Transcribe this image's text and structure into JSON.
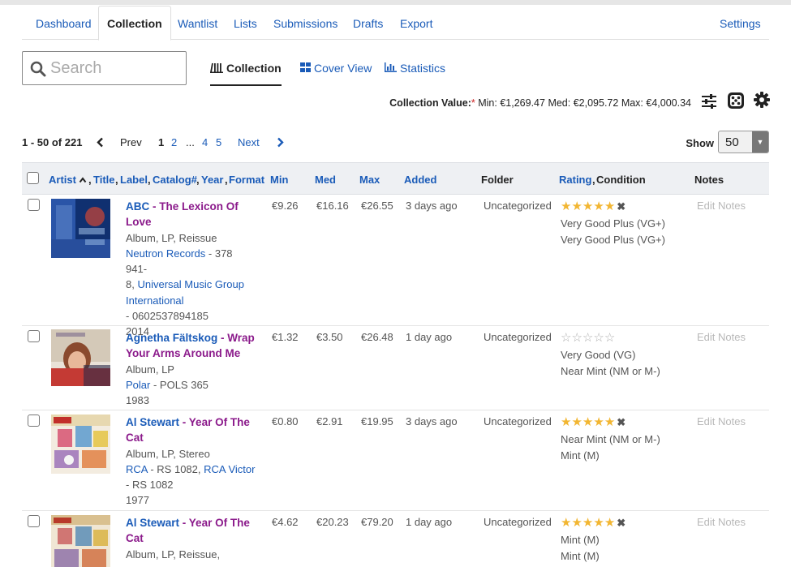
{
  "nav": {
    "tabs": [
      "Dashboard",
      "Collection",
      "Wantlist",
      "Lists",
      "Submissions",
      "Drafts",
      "Export"
    ],
    "active": "Collection",
    "settings": "Settings"
  },
  "search": {
    "placeholder": "Search",
    "value": ""
  },
  "views": {
    "collection": "Collection",
    "cover_view": "Cover View",
    "statistics": "Statistics"
  },
  "collection_value": {
    "label": "Collection Value:",
    "asterisk": "*",
    "min_label": "Min:",
    "min": "€1,269.47",
    "med_label": "Med:",
    "med": "€2,095.72",
    "max_label": "Max:",
    "max": "€4,000.34"
  },
  "pager": {
    "range": "1 - 50 of 221",
    "prev": "Prev",
    "pages": [
      "1",
      "2",
      "...",
      "4",
      "5"
    ],
    "next": "Next"
  },
  "show": {
    "label": "Show",
    "value": "50"
  },
  "table": {
    "headers": {
      "artist": "Artist",
      "title": "Title",
      "label": "Label",
      "catalog": "Catalog#",
      "year": "Year",
      "format": "Format",
      "min": "Min",
      "med": "Med",
      "max": "Max",
      "added": "Added",
      "folder": "Folder",
      "rating": "Rating",
      "condition": "Condition",
      "notes": "Notes"
    },
    "rows": [
      {
        "artist": "ABC",
        "sep": " - ",
        "title_line1": "The Lexicon Of",
        "title_line2": "Love",
        "format": "Album, LP, Reissue",
        "label1": "Neutron Records",
        "cat1": " - 378 941-",
        "cat1b": "8, ",
        "label2": "Universal Music Group",
        "label2b": "International",
        "cat2": "- 0602537894185",
        "year": "2014",
        "min": "€9.26",
        "med": "€16.16",
        "max": "€26.55",
        "added": "3 days ago",
        "folder": "Uncategorized",
        "rating": 5,
        "cond1": "Very Good Plus (VG+)",
        "cond2": "Very Good Plus (VG+)",
        "notes": "Edit Notes"
      },
      {
        "artist": "Agnetha Fältskog",
        "sep": " - ",
        "title_line1": "Wrap",
        "title_line2": "Your Arms Around Me",
        "format": "Album, LP",
        "label1": "Polar",
        "cat1": " - POLS 365",
        "year": "1983",
        "min": "€1.32",
        "med": "€3.50",
        "max": "€26.48",
        "added": "1 day ago",
        "folder": "Uncategorized",
        "rating": 0,
        "cond1": "Very Good (VG)",
        "cond2": "Near Mint (NM or M-)",
        "notes": "Edit Notes"
      },
      {
        "artist": "Al Stewart",
        "sep": " - ",
        "title_line1": "Year Of The",
        "title_line2": "Cat",
        "format": "Album, LP, Stereo",
        "label1": "RCA",
        "cat1": " - RS 1082, ",
        "label2": "RCA Victor",
        "cat2": "- RS 1082",
        "year": "1977",
        "min": "€0.80",
        "med": "€2.91",
        "max": "€19.95",
        "added": "3 days ago",
        "folder": "Uncategorized",
        "rating": 5,
        "cond1": "Near Mint (NM or M-)",
        "cond2": "Mint (M)",
        "notes": "Edit Notes"
      },
      {
        "artist": "Al Stewart",
        "sep": " - ",
        "title_line1": "Year Of The",
        "title_line2": "Cat",
        "format": "Album, LP, Reissue,",
        "min": "€4.62",
        "med": "€20.23",
        "max": "€79.20",
        "added": "1 day ago",
        "folder": "Uncategorized",
        "rating": 5,
        "cond1": "Mint (M)",
        "cond2": "Mint (M)",
        "notes": "Edit Notes"
      }
    ]
  },
  "colors": {
    "link": "#1a5bb8",
    "title": "#8b1a8b",
    "star": "#f2b632",
    "header_bg": "#eef0f3"
  },
  "icons": [
    "search-icon",
    "collection-icon",
    "cover-view-icon",
    "statistics-icon",
    "sliders-icon",
    "dice-icon",
    "gear-icon",
    "chevron-left-icon",
    "chevron-right-icon",
    "sort-up-icon",
    "star-icon",
    "remove-rating-icon"
  ]
}
